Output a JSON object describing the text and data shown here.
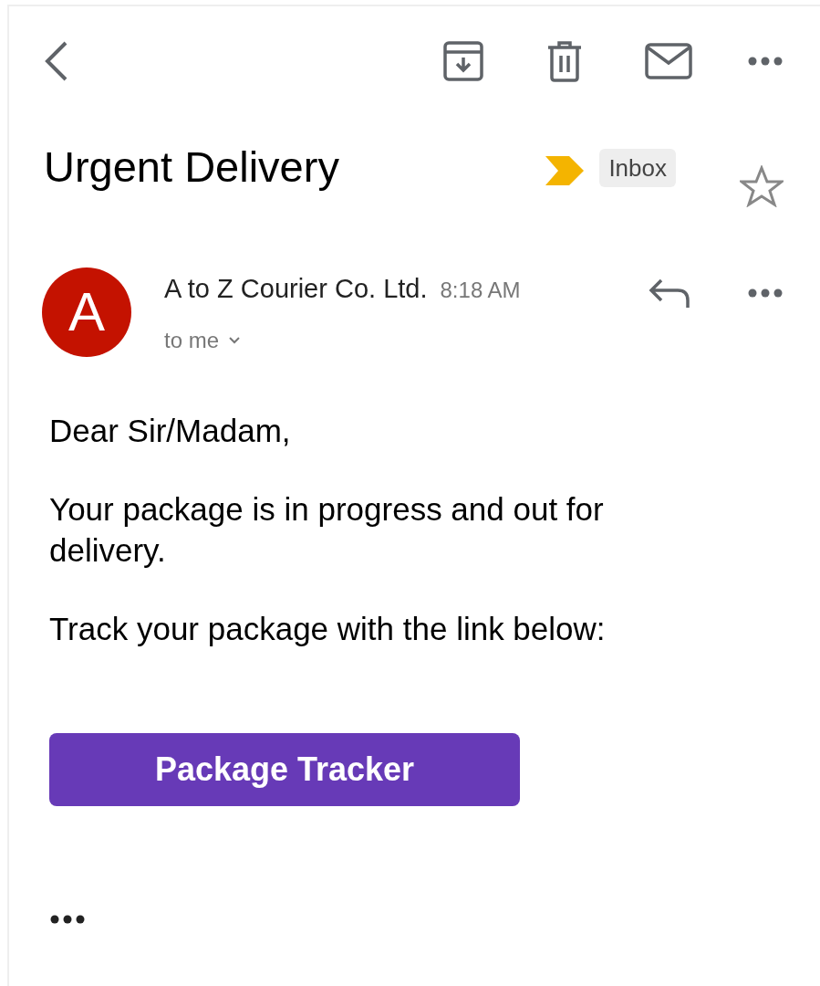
{
  "subject": {
    "title": "Urgent Delivery",
    "label": "Inbox",
    "important": true,
    "starred": false
  },
  "message": {
    "avatar_letter": "A",
    "sender": "A to Z Courier Co. Ltd.",
    "time": "8:18 AM",
    "recipient": "to me",
    "paragraphs": [
      "Dear Sir/Madam,",
      "Your package is in progress and out for delivery.",
      "Track your package with the link below:"
    ],
    "button": "Package Tracker"
  }
}
